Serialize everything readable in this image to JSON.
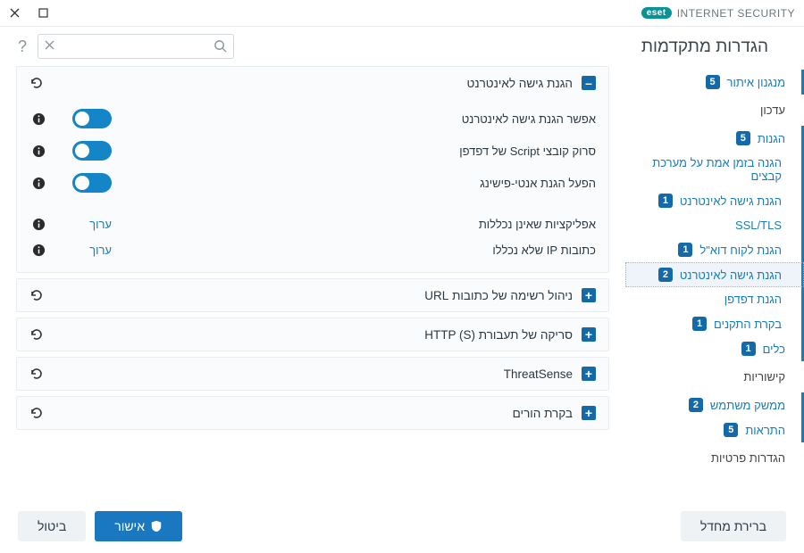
{
  "app": {
    "brand_pill": "eset",
    "brand_text": "INTERNET SECURITY"
  },
  "title": "הגדרות מתקדמות",
  "search": {
    "value": "",
    "placeholder": ""
  },
  "sidebar": [
    {
      "label": "מנגנון איתור",
      "badge": "5",
      "type": "group"
    },
    {
      "label": "עדכון",
      "type": "plain"
    },
    {
      "label": "הגנות",
      "badge": "5",
      "type": "group"
    },
    {
      "label": "הגנה בזמן אמת על מערכת קבצים",
      "type": "sub",
      "badge": null
    },
    {
      "label": "הגנת גישה לאינטרנט",
      "type": "sub",
      "badge": "1"
    },
    {
      "label": "SSL/TLS",
      "type": "sub",
      "badge": null
    },
    {
      "label": "הגנת לקוח דוא\"ל",
      "type": "sub",
      "badge": "1"
    },
    {
      "label": "הגנת גישה לאינטרנט",
      "type": "sub",
      "badge": "2",
      "active": true
    },
    {
      "label": "הגנת דפדפן",
      "type": "sub",
      "badge": null
    },
    {
      "label": "בקרת התקנים",
      "type": "sub",
      "badge": "1"
    },
    {
      "label": "כלים",
      "badge": "1",
      "type": "group"
    },
    {
      "label": "קישוריות",
      "type": "plain"
    },
    {
      "label": "ממשק משתמש",
      "badge": "2",
      "type": "group"
    },
    {
      "label": "התראות",
      "badge": "5",
      "type": "group"
    },
    {
      "label": "הגדרות פרטיות",
      "type": "plain"
    }
  ],
  "sections": [
    {
      "title": "הגנת גישה לאינטרנט",
      "expanded": true,
      "rows": [
        {
          "label": "אפשר הגנת גישה לאינטרנט",
          "ctrl": "toggle"
        },
        {
          "label": "סרוק קובצי Script של דפדפן",
          "ctrl": "toggle"
        },
        {
          "label": "הפעל הגנת אנטי-פישינג",
          "ctrl": "toggle"
        },
        {
          "label": "אפליקציות שאינן נכללות",
          "ctrl": "link",
          "link": "ערוך"
        },
        {
          "label": "כתובות IP שלא נכללו",
          "ctrl": "link",
          "link": "ערוך"
        }
      ]
    },
    {
      "title": "ניהול רשימה של כתובות URL",
      "expanded": false
    },
    {
      "title": "סריקה של תעבורת HTTP (S)‎",
      "expanded": false
    },
    {
      "title": "ThreatSense",
      "expanded": false
    },
    {
      "title": "בקרת הורים",
      "expanded": false
    }
  ],
  "footer": {
    "default": "ברירת מחדל",
    "ok": "אישור",
    "cancel": "ביטול"
  }
}
